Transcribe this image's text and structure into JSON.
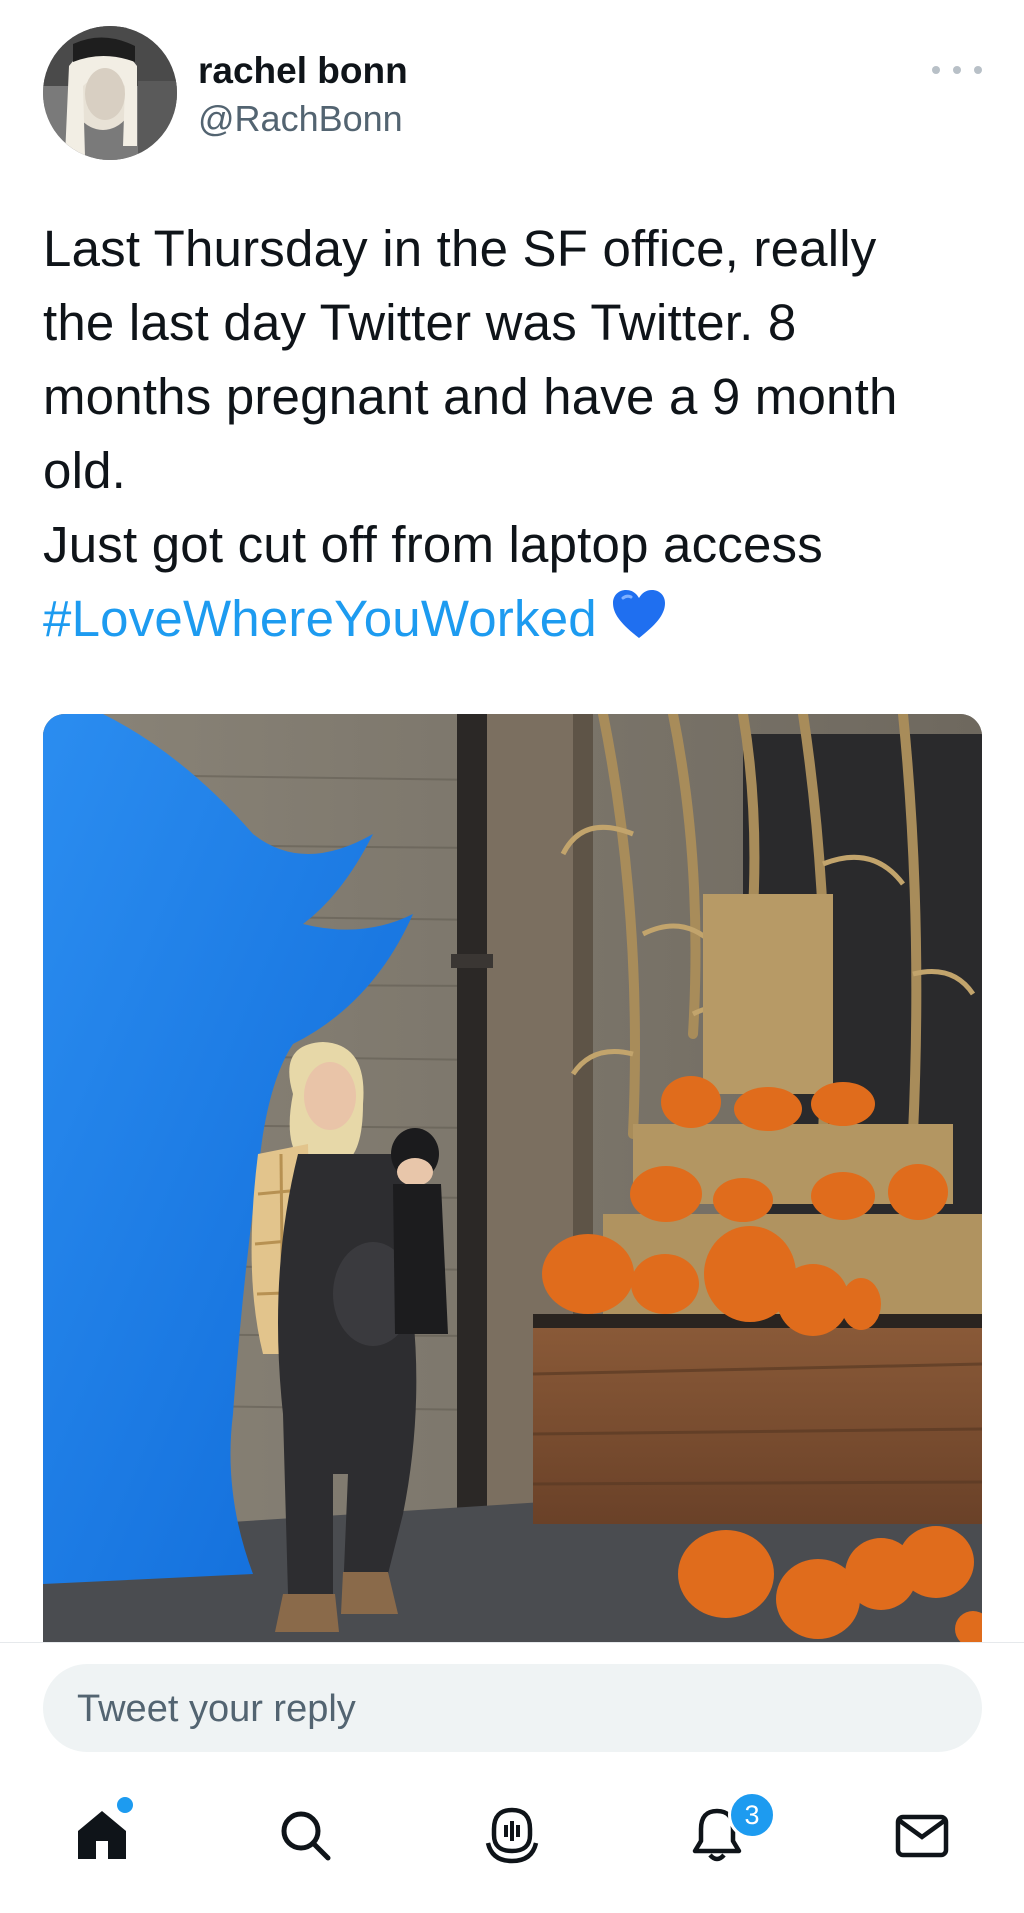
{
  "author": {
    "name": "rachel bonn",
    "handle": "@RachBonn"
  },
  "tweet": {
    "lines": [
      "Last Thursday in the SF office, really",
      "the last day Twitter was Twitter. 8",
      "months pregnant and have a 9 month",
      "old.",
      "Just got cut off from laptop access"
    ],
    "hashtag": "#LoveWhereYouWorked",
    "emoji": "blue-heart-icon"
  },
  "reply": {
    "placeholder": "Tweet your reply"
  },
  "nav": {
    "items": [
      "home-icon",
      "search-icon",
      "spaces-icon",
      "notifications-icon",
      "messages-icon"
    ],
    "notifications_badge": "3"
  },
  "colors": {
    "accent": "#1d9bf0",
    "text": "#0f1419",
    "secondary": "#536471"
  }
}
